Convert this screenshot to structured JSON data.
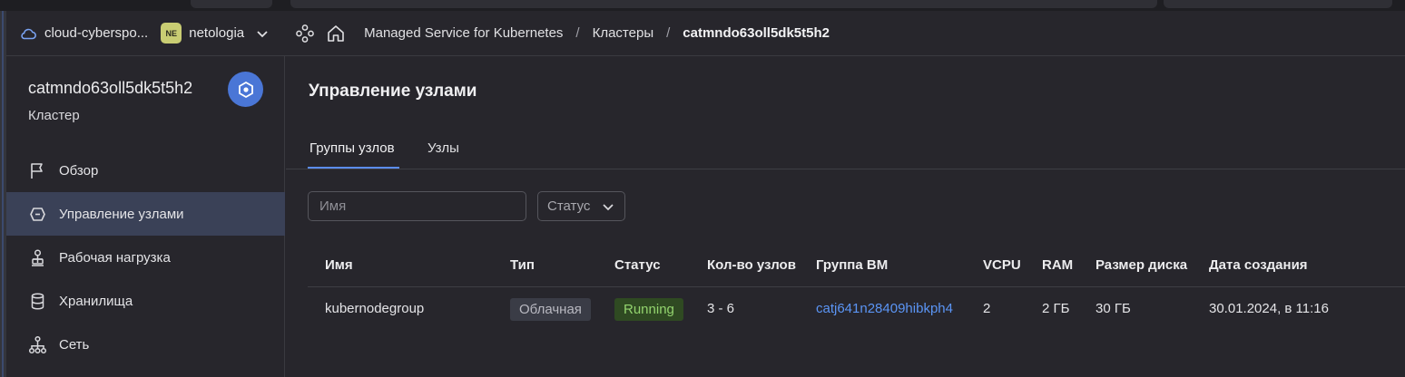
{
  "header": {
    "cloud_name": "cloud-cyberspo...",
    "folder_badge": "NE",
    "folder_name": "netologia",
    "breadcrumbs": [
      "Managed Service for Kubernetes",
      "Кластеры",
      "catmndo63oll5dk5t5h2"
    ],
    "separator": "/"
  },
  "sidebar": {
    "cluster_name": "catmndo63oll5dk5t5h2",
    "cluster_subtitle": "Кластер",
    "items": [
      {
        "label": "Обзор",
        "icon": "flag-icon"
      },
      {
        "label": "Управление узлами",
        "icon": "node-management-icon"
      },
      {
        "label": "Рабочая нагрузка",
        "icon": "workload-icon"
      },
      {
        "label": "Хранилища",
        "icon": "database-icon"
      },
      {
        "label": "Сеть",
        "icon": "network-icon"
      }
    ],
    "active_index": 1
  },
  "main": {
    "title": "Управление узлами",
    "tabs": [
      {
        "label": "Группы узлов",
        "active": true
      },
      {
        "label": "Узлы",
        "active": false
      }
    ],
    "filters": {
      "name_placeholder": "Имя",
      "status_label": "Статус"
    },
    "table": {
      "columns": [
        "Имя",
        "Тип",
        "Статус",
        "Кол-во узлов",
        "Группа ВМ",
        "VCPU",
        "RAM",
        "Размер диска",
        "Дата создания"
      ],
      "rows": [
        {
          "name": "kubernodegroup",
          "type": "Облачная",
          "status": "Running",
          "nodes": "3 - 6",
          "vm_group": "catj641n28409hibkph4",
          "vcpu": "2",
          "ram": "2 ГБ",
          "disk": "30 ГБ",
          "created": "30.01.2024, в 11:16"
        }
      ]
    }
  },
  "colors": {
    "accent": "#5b8def",
    "link": "#5b95f5",
    "status_running_bg": "#2f4a22",
    "status_running_text": "#93d46e",
    "active_nav_bg": "#3a4157"
  }
}
